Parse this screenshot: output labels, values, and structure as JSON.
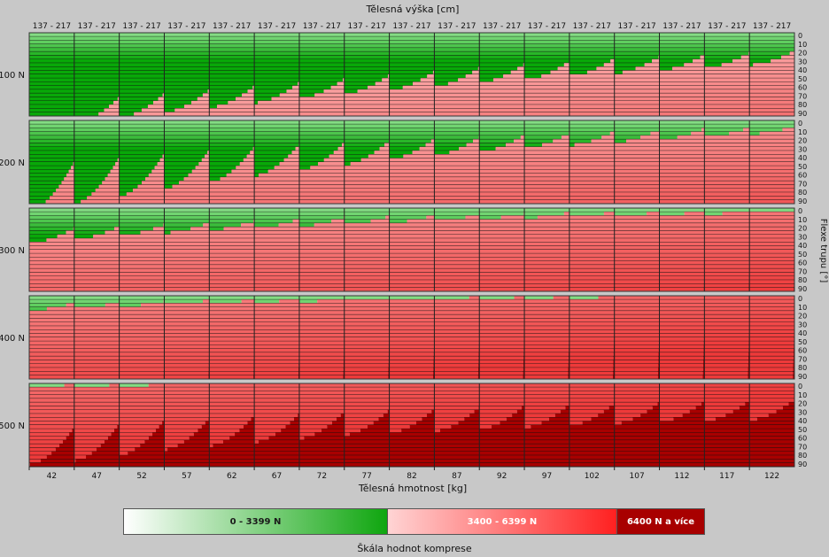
{
  "chart_data": {
    "type": "heatmap",
    "title": "Tělesná výška [cm]",
    "xlabel": "Tělesná hmotnost [kg]",
    "ylabel": "Flexe trupu [°]",
    "height_range_label": "137 - 217",
    "weights": [
      "42",
      "47",
      "52",
      "57",
      "62",
      "67",
      "72",
      "77",
      "82",
      "87",
      "92",
      "97",
      "102",
      "107",
      "112",
      "117",
      "122"
    ],
    "loads": [
      "100 N",
      "200 N",
      "300 N",
      "400 N",
      "500 N"
    ],
    "flexion_ticks": [
      "0",
      "10",
      "20",
      "30",
      "40",
      "50",
      "60",
      "70",
      "80",
      "90"
    ],
    "green_boundary_flexion_deg": {
      "100 N": {
        "at_shortest_height": [
          999,
          98,
          92,
          86,
          81,
          76,
          71,
          66,
          62,
          58,
          54,
          51,
          47,
          44,
          41,
          38,
          35
        ],
        "at_tallest_height": [
          999,
          70,
          66,
          62,
          58,
          54,
          50,
          46,
          42,
          38,
          34,
          31,
          28,
          26,
          24,
          22,
          20
        ]
      },
      "200 N": {
        "at_shortest_height": [
          98,
          90,
          82,
          74,
          67,
          60,
          54,
          48,
          42,
          38,
          34,
          30,
          27,
          24,
          21,
          18,
          15
        ],
        "at_tallest_height": [
          45,
          40,
          36,
          32,
          29,
          26,
          24,
          22,
          20,
          18,
          16,
          14,
          12,
          10,
          9,
          8,
          7
        ]
      },
      "300 N": {
        "at_shortest_height": [
          38,
          34,
          30,
          27,
          24,
          22,
          20,
          18,
          16,
          14,
          12,
          11,
          10,
          9,
          8,
          7,
          6
        ],
        "at_tallest_height": [
          22,
          20,
          18,
          16,
          14,
          12,
          10,
          9,
          8,
          7,
          6,
          5,
          4,
          4,
          3,
          3,
          2
        ]
      },
      "400 N": {
        "at_shortest_height": [
          16,
          14,
          12,
          10,
          9,
          8,
          7,
          6,
          5,
          4,
          4,
          3,
          3,
          2,
          2,
          2,
          1
        ],
        "at_tallest_height": [
          8,
          7,
          6,
          5,
          4,
          3,
          3,
          2,
          2,
          1,
          1,
          1,
          1,
          1,
          1,
          1,
          1
        ]
      },
      "500 N": {
        "at_shortest_height": [
          6,
          6,
          4,
          0,
          0,
          0,
          0,
          0,
          0,
          0,
          0,
          0,
          0,
          0,
          0,
          0,
          0
        ],
        "at_tallest_height": [
          0,
          0,
          0,
          0,
          0,
          0,
          0,
          0,
          0,
          0,
          0,
          0,
          0,
          0,
          0,
          0,
          0
        ]
      }
    },
    "dark_onset_flexion_deg": {
      "100 N": {
        "at_shortest_height": [
          999,
          999,
          999,
          999,
          999,
          999,
          999,
          999,
          999,
          999,
          999,
          999,
          999,
          999,
          999,
          999,
          999
        ],
        "at_tallest_height": [
          999,
          999,
          999,
          999,
          999,
          999,
          999,
          999,
          999,
          999,
          999,
          999,
          999,
          999,
          999,
          999,
          999
        ]
      },
      "200 N": {
        "at_shortest_height": [
          999,
          999,
          999,
          999,
          999,
          999,
          999,
          999,
          999,
          999,
          999,
          999,
          999,
          999,
          999,
          999,
          999
        ],
        "at_tallest_height": [
          999,
          999,
          999,
          999,
          999,
          999,
          999,
          999,
          999,
          999,
          999,
          999,
          999,
          999,
          999,
          999,
          999
        ]
      },
      "300 N": {
        "at_shortest_height": [
          999,
          999,
          999,
          999,
          999,
          999,
          999,
          999,
          999,
          999,
          999,
          999,
          999,
          999,
          999,
          999,
          999
        ],
        "at_tallest_height": [
          999,
          999,
          999,
          999,
          999,
          999,
          999,
          999,
          88,
          84,
          80,
          76,
          73,
          70,
          67,
          64,
          61
        ]
      },
      "400 N": {
        "at_shortest_height": [
          999,
          999,
          999,
          999,
          999,
          999,
          999,
          999,
          999,
          999,
          999,
          999,
          999,
          999,
          999,
          999,
          999
        ],
        "at_tallest_height": [
          72,
          68,
          64,
          60,
          56,
          52,
          48,
          45,
          42,
          40,
          38,
          36,
          34,
          32,
          30,
          29,
          28
        ]
      },
      "500 N": {
        "at_shortest_height": [
          88,
          84,
          78,
          72,
          68,
          64,
          60,
          56,
          54,
          52,
          50,
          48,
          46,
          44,
          42,
          41,
          40
        ],
        "at_tallest_height": [
          48,
          44,
          40,
          38,
          35,
          33,
          31,
          29,
          28,
          26,
          24,
          23,
          22,
          21,
          20,
          19,
          18
        ]
      }
    },
    "legend": {
      "title": "Škála hodnot komprese",
      "ranges": [
        "0 - 3399 N",
        "3400 - 6399 N",
        "6400 N a více"
      ]
    },
    "colors": {
      "background": "#c8c8c8",
      "green_dark": "#08a808",
      "green_light": "#b8f2b8",
      "pink_light": "#ffd8d8",
      "red": "#ee3a3a",
      "dark_red": "#a80000",
      "row_line": "#111111"
    }
  }
}
